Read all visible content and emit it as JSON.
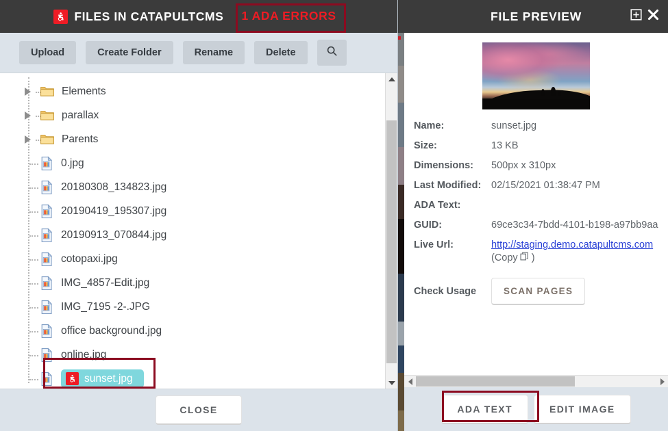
{
  "file_manager": {
    "header": {
      "ada_icon": "accessibility-icon",
      "title": "FILES IN CATAPULTCMS",
      "ada_errors": "1 ADA ERRORS",
      "ada_errors_color": "#ed1c24",
      "annotation_color": "#8c0b20",
      "background": "#3b3b3b"
    },
    "toolbar": {
      "upload": "Upload",
      "create_folder": "Create Folder",
      "rename": "Rename",
      "delete": "Delete",
      "search_icon": "search-icon"
    },
    "tree": [
      {
        "label": "Elements",
        "type": "folder",
        "expandable": true,
        "selected": false
      },
      {
        "label": "parallax",
        "type": "folder",
        "expandable": true,
        "selected": false
      },
      {
        "label": "Parents",
        "type": "folder",
        "expandable": true,
        "selected": false
      },
      {
        "label": "0.jpg",
        "type": "file",
        "expandable": false,
        "selected": false
      },
      {
        "label": "20180308_134823.jpg",
        "type": "file",
        "expandable": false,
        "selected": false
      },
      {
        "label": "20190419_195307.jpg",
        "type": "file",
        "expandable": false,
        "selected": false
      },
      {
        "label": "20190913_070844.jpg",
        "type": "file",
        "expandable": false,
        "selected": false
      },
      {
        "label": "cotopaxi.jpg",
        "type": "file",
        "expandable": false,
        "selected": false
      },
      {
        "label": "IMG_4857-Edit.jpg",
        "type": "file",
        "expandable": false,
        "selected": false
      },
      {
        "label": "IMG_7195 -2-.JPG",
        "type": "file",
        "expandable": false,
        "selected": false
      },
      {
        "label": "office background.jpg",
        "type": "file",
        "expandable": false,
        "selected": false
      },
      {
        "label": "online.jpg",
        "type": "file",
        "expandable": false,
        "selected": false
      },
      {
        "label": "sunset.jpg",
        "type": "file",
        "expandable": false,
        "selected": true,
        "has_ada_flag": true
      }
    ],
    "selection_color": "#7fd7dd",
    "footer": {
      "close": "CLOSE"
    }
  },
  "preview": {
    "header": {
      "title": "FILE PREVIEW",
      "maximize_icon": "maximize-icon",
      "close_icon": "close-icon"
    },
    "thumbnail_alt": "sunset-thumbnail",
    "fields": {
      "name_label": "Name:",
      "name_value": "sunset.jpg",
      "size_label": "Size:",
      "size_value": "13 KB",
      "dimensions_label": "Dimensions:",
      "dimensions_value": "500px x 310px",
      "modified_label": "Last Modified:",
      "modified_value": "02/15/2021 01:38:47 PM",
      "ada_text_label": "ADA Text:",
      "ada_text_value": "",
      "guid_label": "GUID:",
      "guid_value": "69ce3c34-7bdd-4101-b198-a97bb9aa",
      "live_url_label": "Live Url:",
      "live_url_value": "http://staging.demo.catapultcms.com",
      "copy_label": "(Copy",
      "copy_icon": "copy-icon",
      "copy_close": ")",
      "usage_label": "Check Usage",
      "scan_button": "SCAN PAGES"
    },
    "footer": {
      "ada_text_button": "ADA TEXT",
      "edit_image_button": "EDIT IMAGE",
      "annotation_color": "#8c0b20"
    }
  }
}
